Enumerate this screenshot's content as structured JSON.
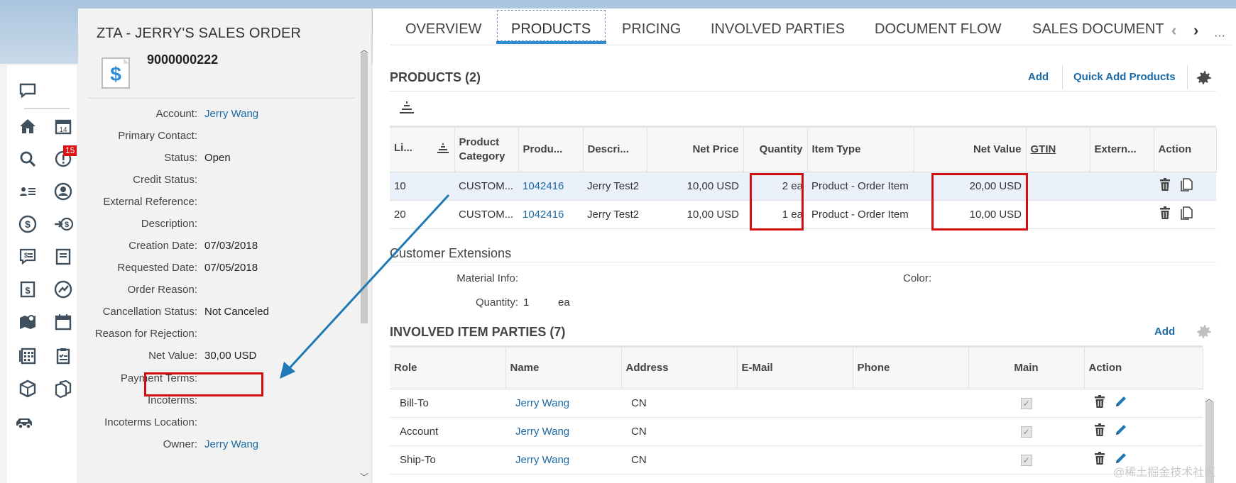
{
  "colors": {
    "accent": "#2e8bd5",
    "link": "#1b6aa5",
    "highlight": "#d20f0f",
    "arrow": "#1f79b5"
  },
  "rail": {
    "badge": "15",
    "icons": [
      "chat-icon",
      "home-icon",
      "calendar-icon",
      "search-icon",
      "alert-icon",
      "contacts-icon",
      "account-icon",
      "dollar-icon",
      "transfer-icon",
      "list-icon",
      "book-icon",
      "invoice-icon",
      "growth-icon",
      "map-icon",
      "agenda-icon",
      "calculator-icon",
      "clipboard-icon",
      "box-icon",
      "boxes-icon",
      "car-icon"
    ],
    "calendar_day": "14"
  },
  "panel": {
    "title": "ZTA - JERRY'S SALES ORDER",
    "doc_number": "9000000222",
    "fields": [
      {
        "label": "Account:",
        "value": "Jerry Wang",
        "link": true
      },
      {
        "label": "Primary Contact:",
        "value": ""
      },
      {
        "label": "Status:",
        "value": "Open"
      },
      {
        "label": "Credit Status:",
        "value": ""
      },
      {
        "label": "External Reference:",
        "value": ""
      },
      {
        "label": "Description:",
        "value": ""
      },
      {
        "label": "Creation Date:",
        "value": "07/03/2018"
      },
      {
        "label": "Requested Date:",
        "value": "07/05/2018"
      },
      {
        "label": "Order Reason:",
        "value": ""
      },
      {
        "label": "Cancellation Status:",
        "value": "Not Canceled"
      },
      {
        "label": "Reason for Rejection:",
        "value": ""
      },
      {
        "label": "Net Value:",
        "value": "30,00 USD"
      },
      {
        "label": "Payment Terms:",
        "value": ""
      },
      {
        "label": "Incoterms:",
        "value": ""
      },
      {
        "label": "Incoterms Location:",
        "value": ""
      },
      {
        "label": "Owner:",
        "value": "Jerry Wang",
        "link": true
      }
    ]
  },
  "tabs": [
    "OVERVIEW",
    "PRODUCTS",
    "PRICING",
    "INVOLVED PARTIES",
    "DOCUMENT FLOW",
    "SALES DOCUMENT"
  ],
  "products": {
    "title": "PRODUCTS (2)",
    "add": "Add",
    "quick_add": "Quick Add Products",
    "columns": [
      "Li...",
      "Product Category",
      "Produ...",
      "Descri...",
      "Net Price",
      "Quantity",
      "Item Type",
      "Net Value",
      "GTIN",
      "Extern...",
      "Action"
    ],
    "rows": [
      {
        "line": "10",
        "category": "CUSTOM...",
        "product": "1042416",
        "description": "Jerry Test2",
        "net_price": "10,00  USD",
        "quantity": "2 ea",
        "item_type": "Product - Order Item",
        "net_value": "20,00  USD",
        "gtin": "",
        "external": ""
      },
      {
        "line": "20",
        "category": "CUSTOM...",
        "product": "1042416",
        "description": "Jerry Test2",
        "net_price": "10,00  USD",
        "quantity": "1 ea",
        "item_type": "Product - Order Item",
        "net_value": "10,00  USD",
        "gtin": "",
        "external": ""
      }
    ]
  },
  "extensions": {
    "title": "Customer Extensions",
    "material_label": "Material Info:",
    "color_label": "Color:",
    "quantity_label": "Quantity:",
    "quantity_value": "1",
    "quantity_unit": "ea"
  },
  "parties": {
    "title": "INVOLVED ITEM PARTIES (7)",
    "add": "Add",
    "columns": [
      "Role",
      "Name",
      "Address",
      "E-Mail",
      "Phone",
      "Main",
      "Action"
    ],
    "rows": [
      {
        "role": "Bill-To",
        "name": "Jerry Wang",
        "address": "CN",
        "email": "",
        "phone": "",
        "main": "✓"
      },
      {
        "role": "Account",
        "name": "Jerry Wang",
        "address": "CN",
        "email": "",
        "phone": "",
        "main": "✓"
      },
      {
        "role": "Ship-To",
        "name": "Jerry Wang",
        "address": "CN",
        "email": "",
        "phone": "",
        "main": "✓"
      }
    ]
  },
  "watermark": "@稀土掘金技术社区"
}
